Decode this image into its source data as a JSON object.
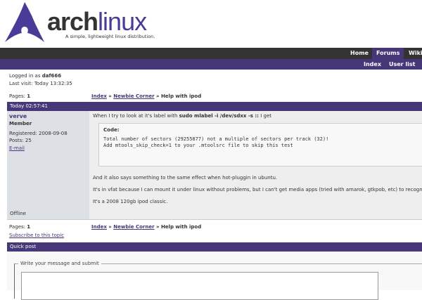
{
  "logo": {
    "name_bold": "arch",
    "name_light": "linux",
    "tagline": "A simple, lightweight linux distribution."
  },
  "nav": {
    "top": [
      "Home",
      "Forums",
      "Wiki"
    ],
    "sub": [
      "Index",
      "User list"
    ]
  },
  "user": {
    "logged_prefix": "Logged in as ",
    "username": "daf666",
    "last_visit": "Last visit: Today 13:32:35"
  },
  "pages": {
    "label": "Pages: ",
    "value": "1"
  },
  "breadcrumb": {
    "index": "Index",
    "sep": " » ",
    "forum": "Newbie Corner",
    "topic": "Help with ipod"
  },
  "post": {
    "time": "Today 02:57:41",
    "author": "verve",
    "rank": "Member",
    "registered": "Registered: 2008-09-08",
    "posts": "Posts: 25",
    "email": "E-mail",
    "status": "Offline",
    "intro": "When I try to look at it's label with ",
    "cmd": "sudo mlabel -i /dev/sdxx -s ::",
    "intro_end": " I get",
    "code_label": "Code:",
    "code": "Total number of sectors (29255877) not a multiple of sectors per track (32)!\nAdd mtools_skip_check=1 to your .mtoolsrc file to skip this test",
    "p1": "And it also says something to the same effect when hot-pluggin in ubuntu.",
    "p2": "It's in vfat because I can mount it under linux without problems, but I can't get media apps (tried with amarok, gtkpob, etc) to recognize th",
    "p3": "It's a 2008 120gb ipod classic."
  },
  "subscribe": "Subscribe to this topic",
  "quickpost": {
    "title": "Quick post",
    "legend": "Write your message and submit"
  }
}
